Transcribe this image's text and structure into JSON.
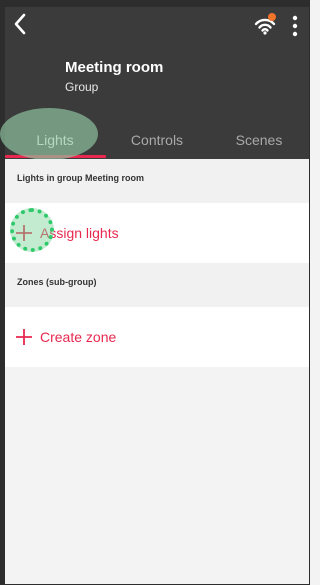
{
  "header": {
    "title": "Meeting room",
    "subtitle": "Group",
    "back_icon": "chevron-left-icon",
    "connection_icon": "wifi-signal-icon",
    "connection_badge_color": "#f2742b",
    "menu_icon": "more-vertical-icon"
  },
  "tabs": [
    {
      "label": "Lights",
      "active": true
    },
    {
      "label": "Controls",
      "active": false
    },
    {
      "label": "Scenes",
      "active": false
    }
  ],
  "sections": {
    "lights_header": "Lights in group Meeting room",
    "assign_label": "Assign lights",
    "zones_header": "Zones (sub-group)",
    "create_zone_label": "Create zone"
  },
  "colors": {
    "header_bg": "#3b3b3b",
    "accent": "#e8284f",
    "background": "#f3f3f3"
  }
}
